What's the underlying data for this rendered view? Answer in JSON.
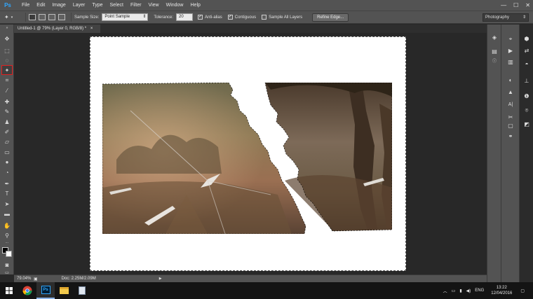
{
  "app": {
    "logo": "Ps"
  },
  "menu": [
    "File",
    "Edit",
    "Image",
    "Layer",
    "Type",
    "Select",
    "Filter",
    "View",
    "Window",
    "Help"
  ],
  "window_controls": {
    "minimize": "—",
    "maximize": "☐",
    "close": "✕"
  },
  "options": {
    "tool_icon": "magic-wand-icon",
    "sample_size_label": "Sample Size:",
    "sample_size_value": "Point Sample",
    "tolerance_label": "Tolerance:",
    "tolerance_value": "20",
    "anti_alias_label": "Anti-alias",
    "anti_alias_checked": true,
    "contiguous_label": "Contiguous",
    "contiguous_checked": true,
    "sample_all_layers_label": "Sample All Layers",
    "sample_all_layers_checked": false,
    "refine_edge_label": "Refine Edge...",
    "workspace": "Photography"
  },
  "document": {
    "tab_title": "Untitled-1 @ 79% (Layer 0, RGB/8) *",
    "close": "×"
  },
  "status": {
    "zoom": "79.04%",
    "doc_info": "Doc: 2.25M/2.09M"
  },
  "taskbar": {
    "apps": [
      "chrome-icon",
      "photoshop-icon",
      "file-explorer-icon",
      "notepad-icon"
    ],
    "language": "ENG",
    "time": "13:22",
    "date": "12/04/2016"
  },
  "colors": {
    "ui_panel": "#535353",
    "pasteboard": "#282828",
    "active_tool_outline": "#e02020",
    "ps_blue": "#31a8ff"
  }
}
